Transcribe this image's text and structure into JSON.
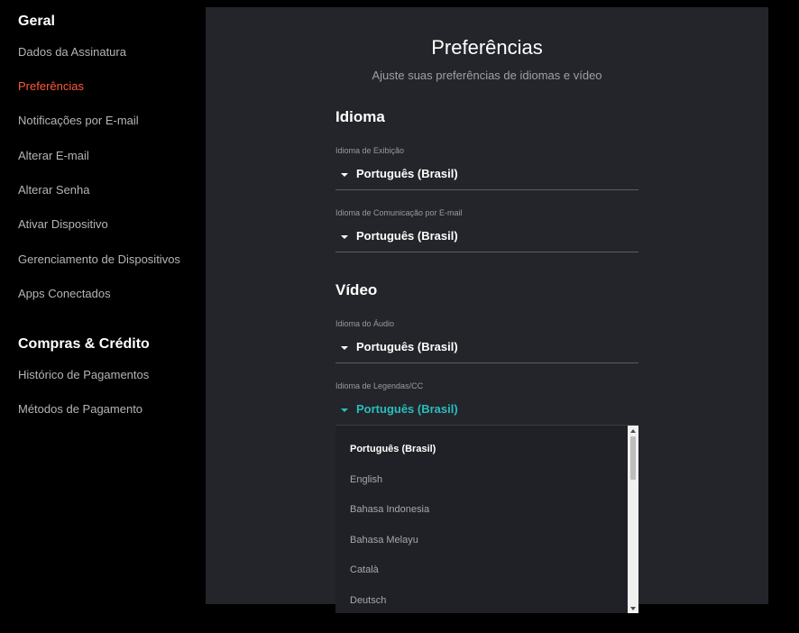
{
  "sidebar": {
    "general_heading": "Geral",
    "general_items": [
      {
        "label": "Dados da Assinatura",
        "active": false
      },
      {
        "label": "Preferências",
        "active": true
      },
      {
        "label": "Notificações por E-mail",
        "active": false
      },
      {
        "label": "Alterar E-mail",
        "active": false
      },
      {
        "label": "Alterar Senha",
        "active": false
      },
      {
        "label": "Ativar Dispositivo",
        "active": false
      },
      {
        "label": "Gerenciamento de Dispositivos",
        "active": false
      },
      {
        "label": "Apps Conectados",
        "active": false
      }
    ],
    "purchases_heading": "Compras & Crédito",
    "purchases_items": [
      {
        "label": "Histórico de Pagamentos"
      },
      {
        "label": "Métodos de Pagamento"
      }
    ]
  },
  "main": {
    "title": "Preferências",
    "subtitle": "Ajuste suas preferências de idiomas e vídeo",
    "language_section": {
      "heading": "Idioma",
      "display_language": {
        "label": "Idioma de Exibição",
        "value": "Português (Brasil)"
      },
      "email_language": {
        "label": "Idioma de Comunicação por E-mail",
        "value": "Português (Brasil)"
      }
    },
    "video_section": {
      "heading": "Vídeo",
      "audio_language": {
        "label": "Idioma do Áudio",
        "value": "Português (Brasil)"
      },
      "subtitle_language": {
        "label": "Idioma de Legendas/CC",
        "value": "Português (Brasil)",
        "open": true
      }
    },
    "subtitle_options": [
      "Português (Brasil)",
      "English",
      "Bahasa Indonesia",
      "Bahasa Melayu",
      "Català",
      "Deutsch"
    ]
  },
  "colors": {
    "background": "#000000",
    "panel": "#23252b",
    "active_link": "#ff5a38",
    "open_select_accent": "#2abdbb"
  }
}
